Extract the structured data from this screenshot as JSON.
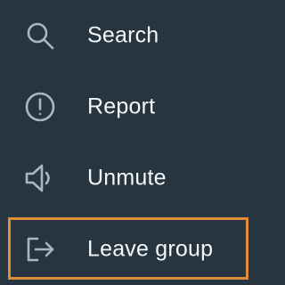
{
  "menu": {
    "items": [
      {
        "id": "search",
        "label": "Search",
        "icon": "search-icon"
      },
      {
        "id": "report",
        "label": "Report",
        "icon": "alert-circle-icon"
      },
      {
        "id": "unmute",
        "label": "Unmute",
        "icon": "speaker-icon"
      },
      {
        "id": "leave",
        "label": "Leave group",
        "icon": "exit-icon"
      }
    ]
  },
  "colors": {
    "background": "#263540",
    "text": "#f4f7f9",
    "icon": "#aab7c0",
    "highlight_border": "#e08a3c"
  }
}
